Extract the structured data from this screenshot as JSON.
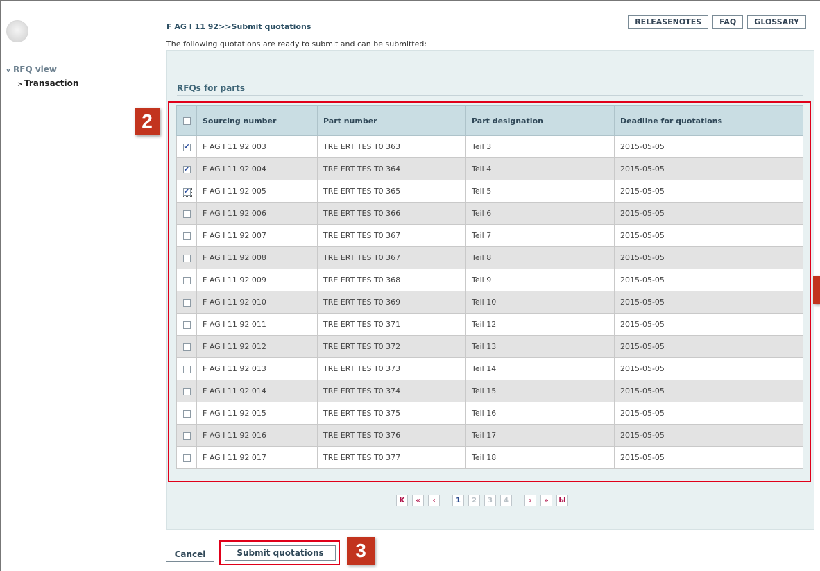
{
  "sidebar": {
    "items": [
      {
        "label": "RFQ view",
        "chevron": "v"
      },
      {
        "label": "Transaction",
        "chevron": ">"
      }
    ]
  },
  "header": {
    "breadcrumb": "F AG I 11 92>>Submit quotations",
    "intro": "The following quotations are ready to submit and can be submitted:",
    "buttons": {
      "releasenotes": "RELEASENOTES",
      "faq": "FAQ",
      "glossary": "GLOSSARY"
    }
  },
  "section": {
    "title": "RFQs for parts"
  },
  "table": {
    "columns": [
      "Sourcing number",
      "Part number",
      "Part designation",
      "Deadline for quotations"
    ],
    "rows": [
      {
        "sourcing": "F AG I 11 92 003",
        "part": "TRE ERT TES T0 363",
        "designation": "Teil 3",
        "deadline": "2015-05-05",
        "checked": true
      },
      {
        "sourcing": "F AG I 11 92 004",
        "part": "TRE ERT TES T0 364",
        "designation": "Teil 4",
        "deadline": "2015-05-05",
        "checked": true
      },
      {
        "sourcing": "F AG I 11 92 005",
        "part": "TRE ERT TES T0 365",
        "designation": "Teil 5",
        "deadline": "2015-05-05",
        "checked": true
      },
      {
        "sourcing": "F AG I 11 92 006",
        "part": "TRE ERT TES T0 366",
        "designation": "Teil 6",
        "deadline": "2015-05-05",
        "checked": false
      },
      {
        "sourcing": "F AG I 11 92 007",
        "part": "TRE ERT TES T0 367",
        "designation": "Teil 7",
        "deadline": "2015-05-05",
        "checked": false
      },
      {
        "sourcing": "F AG I 11 92 008",
        "part": "TRE ERT TES T0 367",
        "designation": "Teil 8",
        "deadline": "2015-05-05",
        "checked": false
      },
      {
        "sourcing": "F AG I 11 92 009",
        "part": "TRE ERT TES T0 368",
        "designation": "Teil 9",
        "deadline": "2015-05-05",
        "checked": false
      },
      {
        "sourcing": "F AG I 11 92 010",
        "part": "TRE ERT TES T0 369",
        "designation": "Teil 10",
        "deadline": "2015-05-05",
        "checked": false
      },
      {
        "sourcing": "F AG I 11 92 011",
        "part": "TRE ERT TES T0 371",
        "designation": "Teil 12",
        "deadline": "2015-05-05",
        "checked": false
      },
      {
        "sourcing": "F AG I 11 92 012",
        "part": "TRE ERT TES T0 372",
        "designation": "Teil 13",
        "deadline": "2015-05-05",
        "checked": false
      },
      {
        "sourcing": "F AG I 11 92 013",
        "part": "TRE ERT TES T0 373",
        "designation": "Teil 14",
        "deadline": "2015-05-05",
        "checked": false
      },
      {
        "sourcing": "F AG I 11 92 014",
        "part": "TRE ERT TES T0 374",
        "designation": "Teil 15",
        "deadline": "2015-05-05",
        "checked": false
      },
      {
        "sourcing": "F AG I 11 92 015",
        "part": "TRE ERT TES T0 375",
        "designation": "Teil 16",
        "deadline": "2015-05-05",
        "checked": false
      },
      {
        "sourcing": "F AG I 11 92 016",
        "part": "TRE ERT TES T0 376",
        "designation": "Teil 17",
        "deadline": "2015-05-05",
        "checked": false
      },
      {
        "sourcing": "F AG I 11 92 017",
        "part": "TRE ERT TES T0 377",
        "designation": "Teil 18",
        "deadline": "2015-05-05",
        "checked": false
      }
    ]
  },
  "pager": {
    "first": "K",
    "prev_block": "«",
    "prev": "‹",
    "pages": [
      "1",
      "2",
      "3",
      "4"
    ],
    "current_page": "1",
    "next": "›",
    "next_block": "»",
    "last": "Ы"
  },
  "footer": {
    "cancel": "Cancel",
    "submit": "Submit quotations"
  },
  "annotations": {
    "badge2": "2",
    "badge3": "3"
  },
  "colors": {
    "accent_red": "#e0001a",
    "badge": "#c2341e",
    "panel_bg": "#e8f1f2",
    "header_bg": "#c9dde3"
  }
}
